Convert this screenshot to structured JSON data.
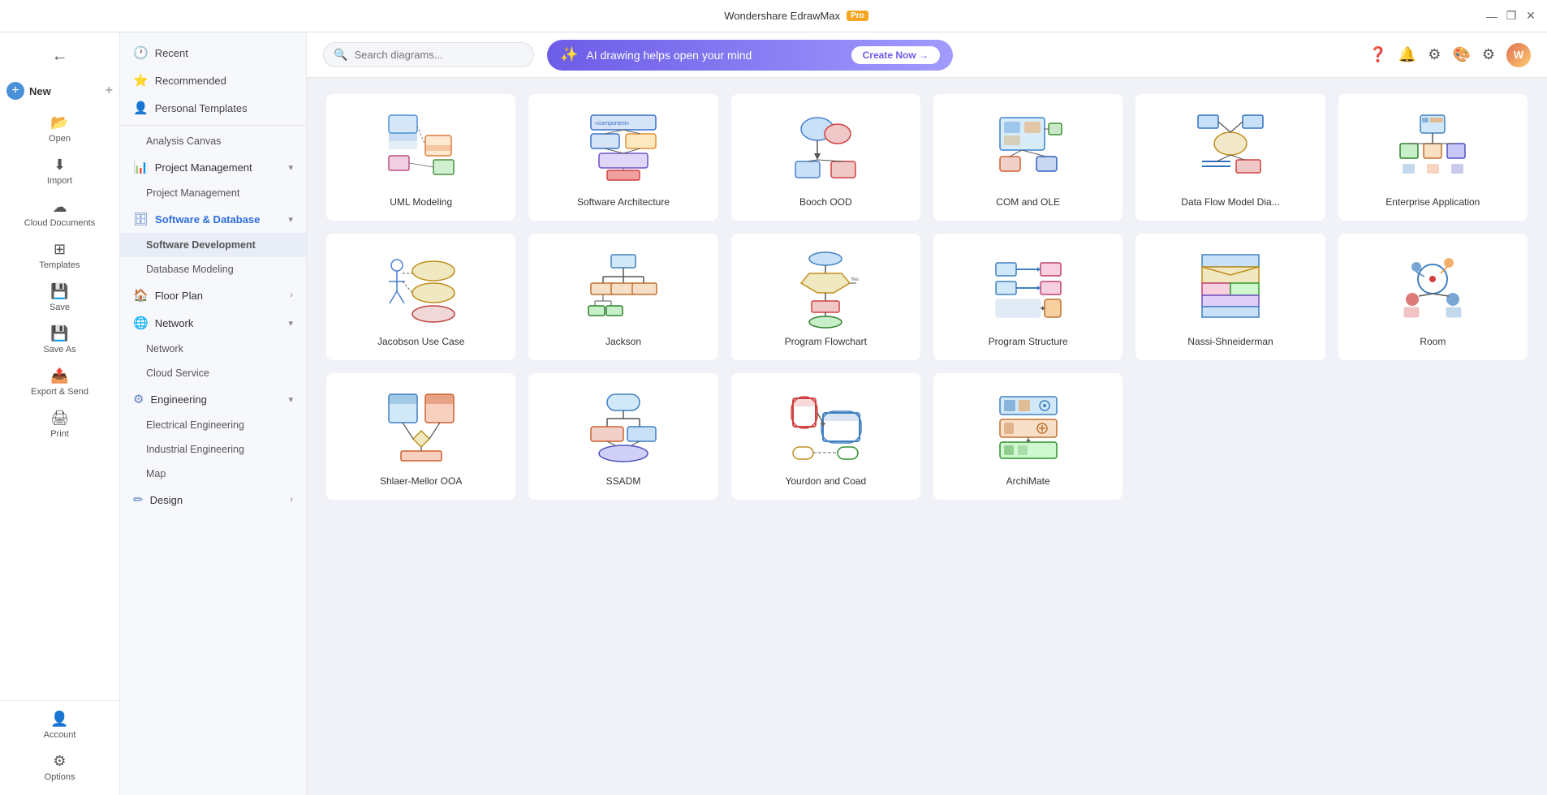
{
  "app": {
    "title": "Wondershare EdrawMax",
    "pro_badge": "Pro"
  },
  "titlebar": {
    "minimize": "—",
    "restore": "❐",
    "close": "✕"
  },
  "topbar": {
    "search_placeholder": "Search diagrams...",
    "ai_text": "AI drawing helps open your mind",
    "ai_btn": "Create Now →",
    "avatar_initials": "W"
  },
  "sidebar_narrow": {
    "items": [
      {
        "id": "new",
        "label": "New",
        "icon": "+"
      },
      {
        "id": "open",
        "label": "Open",
        "icon": "📂"
      },
      {
        "id": "import",
        "label": "Import",
        "icon": "⬇"
      },
      {
        "id": "cloud",
        "label": "Cloud Documents",
        "icon": "☁"
      },
      {
        "id": "templates",
        "label": "Templates",
        "icon": "⊞"
      },
      {
        "id": "save",
        "label": "Save",
        "icon": "💾"
      },
      {
        "id": "saveas",
        "label": "Save As",
        "icon": "💾"
      },
      {
        "id": "export",
        "label": "Export & Send",
        "icon": "📤"
      },
      {
        "id": "print",
        "label": "Print",
        "icon": "🖨"
      }
    ],
    "bottom": [
      {
        "id": "account",
        "label": "Account",
        "icon": "👤"
      },
      {
        "id": "options",
        "label": "Options",
        "icon": "⚙"
      }
    ]
  },
  "sidebar_wide": {
    "sections": [
      {
        "id": "recent",
        "label": "Recent",
        "icon": "🕐",
        "type": "item"
      },
      {
        "id": "recommended",
        "label": "Recommended",
        "icon": "⭐",
        "type": "item"
      },
      {
        "id": "personal",
        "label": "Personal Templates",
        "icon": "👤",
        "type": "item"
      },
      {
        "id": "divider1",
        "type": "divider"
      },
      {
        "id": "analysis",
        "label": "Analysis Canvas",
        "type": "sub"
      },
      {
        "id": "project-mgmt-group",
        "label": "Project Management",
        "icon": "📊",
        "type": "group",
        "expanded": true
      },
      {
        "id": "project-mgmt",
        "label": "Project Management",
        "type": "sub"
      },
      {
        "id": "sw-db-group",
        "label": "Software & Database",
        "icon": "🗄",
        "type": "group",
        "expanded": true,
        "active": true
      },
      {
        "id": "sw-dev",
        "label": "Software Development",
        "type": "sub",
        "active": true
      },
      {
        "id": "db-model",
        "label": "Database Modeling",
        "type": "sub"
      },
      {
        "id": "floor-group",
        "label": "Floor Plan",
        "icon": "🏠",
        "type": "group"
      },
      {
        "id": "network-group",
        "label": "Network",
        "icon": "🌐",
        "type": "group",
        "expanded": true
      },
      {
        "id": "network",
        "label": "Network",
        "type": "sub"
      },
      {
        "id": "cloud-service",
        "label": "Cloud Service",
        "type": "sub"
      },
      {
        "id": "engineering-group",
        "label": "Engineering",
        "icon": "⚙",
        "type": "group",
        "expanded": true
      },
      {
        "id": "electrical",
        "label": "Electrical Engineering",
        "type": "sub"
      },
      {
        "id": "industrial",
        "label": "Industrial Engineering",
        "type": "sub"
      },
      {
        "id": "map",
        "label": "Map",
        "type": "sub"
      },
      {
        "id": "design-group",
        "label": "Design",
        "icon": "✏",
        "type": "group"
      }
    ]
  },
  "templates": [
    {
      "id": "uml",
      "label": "UML Modeling",
      "type": "uml"
    },
    {
      "id": "sw-arch",
      "label": "Software Architecture",
      "type": "sw-arch"
    },
    {
      "id": "booch",
      "label": "Booch OOD",
      "type": "booch"
    },
    {
      "id": "com-ole",
      "label": "COM and OLE",
      "type": "com-ole"
    },
    {
      "id": "data-flow",
      "label": "Data Flow Model Dia...",
      "type": "data-flow"
    },
    {
      "id": "enterprise",
      "label": "Enterprise Application",
      "type": "enterprise"
    },
    {
      "id": "jacobson",
      "label": "Jacobson Use Case",
      "type": "jacobson"
    },
    {
      "id": "jackson",
      "label": "Jackson",
      "type": "jackson"
    },
    {
      "id": "program-flow",
      "label": "Program Flowchart",
      "type": "program-flow"
    },
    {
      "id": "program-struct",
      "label": "Program Structure",
      "type": "program-struct"
    },
    {
      "id": "nassi",
      "label": "Nassi-Shneiderman",
      "type": "nassi"
    },
    {
      "id": "room",
      "label": "Room",
      "type": "room"
    },
    {
      "id": "shlaer",
      "label": "Shlaer-Mellor OOA",
      "type": "shlaer"
    },
    {
      "id": "ssadm",
      "label": "SSADM",
      "type": "ssadm"
    },
    {
      "id": "yourdon",
      "label": "Yourdon and Coad",
      "type": "yourdon"
    },
    {
      "id": "archimate",
      "label": "ArchiMate",
      "type": "archimate"
    }
  ]
}
